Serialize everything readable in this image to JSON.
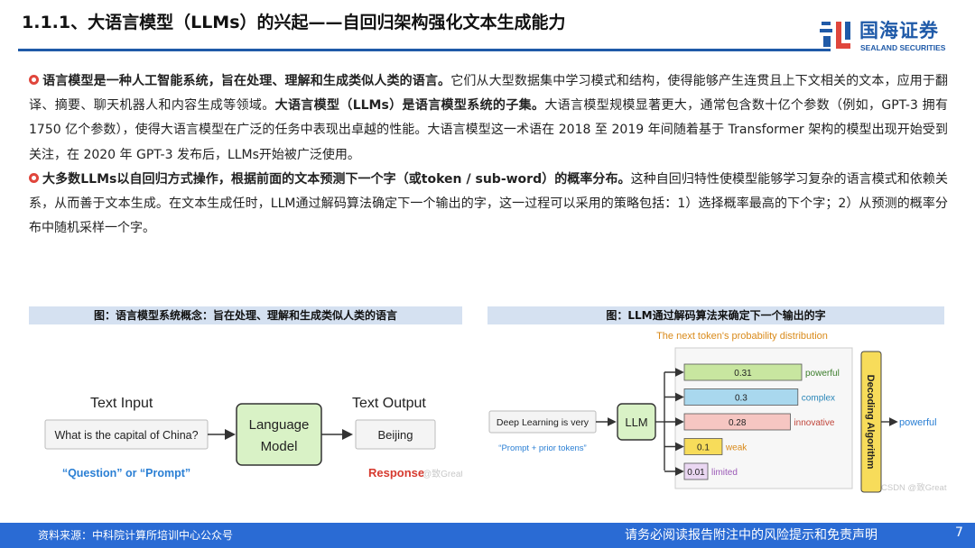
{
  "header": {
    "title": "1.1.1、大语言模型（LLMs）的兴起——自回归架构强化文本生成能力",
    "logo_cn": "国海证券",
    "logo_en": "SEALAND SECURITIES"
  },
  "body": {
    "p1_bold1": "语言模型是一种人工智能系统，旨在处理、理解和生成类似人类的语言。",
    "p1_text1": "它们从大型数据集中学习模式和结构，使得能够产生连贯且上下文相关的文本，应用于翻译、摘要、聊天机器人和内容生成等领域。",
    "p1_bold2": "大语言模型（LLMs）是语言模型系统的子集。",
    "p1_text2": "大语言模型规模显著更大，通常包含数十亿个参数（例如，GPT-3 拥有 1750 亿个参数），使得大语言模型在广泛的任务中表现出卓越的性能。大语言模型这一术语在 2018 至 2019 年间随着基于 Transformer 架构的模型出现开始受到关注，在 2020 年 GPT-3 发布后，LLMs开始被广泛使用。",
    "p2_bold": "大多数LLMs以自回归方式操作，根据前面的文本预测下一个字（或token / sub-word）的概率分布。",
    "p2_text": "这种自回归特性使模型能够学习复杂的语言模式和依赖关系，从而善于文本生成。在文本生成任时，LLM通过解码算法确定下一个输出的字，这一过程可以采用的策略包括：1）选择概率最高的下个字；2）从预测的概率分布中随机采样一个字。"
  },
  "fig_left": {
    "caption": "图：语言模型系统概念：旨在处理、理解和生成类似人类的语言",
    "text_input_label": "Text Input",
    "text_output_label": "Text Output",
    "input_box": "What is the capital of China?",
    "model_line1": "Language",
    "model_line2": "Model",
    "output_box": "Beijing",
    "question_label": "“Question” or “Prompt”",
    "response_label": "Response",
    "watermark": "@致Great"
  },
  "fig_right": {
    "caption": "图：LLM通过解码算法来确定下一个输出的字",
    "dist_title": "The next token's probability distribution",
    "input_box": "Deep Learning is very",
    "prompt_note": "“Prompt + prior tokens”",
    "llm_label": "LLM",
    "decoder_label": "Decoding Algorithm",
    "output_word": "powerful",
    "watermark": "CSDN @致Great",
    "tokens": [
      {
        "prob": 0.31,
        "prob_text": "0.31",
        "word": "powerful",
        "color": "#c8e6a0",
        "word_color": "#3a7d2a"
      },
      {
        "prob": 0.3,
        "prob_text": "0.3",
        "word": "complex",
        "color": "#a9d8ee",
        "word_color": "#2a86b8"
      },
      {
        "prob": 0.28,
        "prob_text": "0.28",
        "word": "innovative",
        "color": "#f6c6c2",
        "word_color": "#c0453a"
      },
      {
        "prob": 0.1,
        "prob_text": "0.1",
        "word": "weak",
        "color": "#f7dc5a",
        "word_color": "#d98a1a"
      },
      {
        "prob": 0.01,
        "prob_text": "0.01",
        "word": "limited",
        "color": "#ead7f2",
        "word_color": "#9b59b6"
      }
    ]
  },
  "footer": {
    "source": "资料来源：中科院计算所培训中心公众号",
    "disclaimer": "请务必阅读报告附注中的风险提示和免责声明",
    "page": "7"
  },
  "colors": {
    "brand_blue": "#1f5aa8",
    "footer_blue": "#2a6bd4",
    "bullet_red": "#e0463c",
    "caption_bg": "#d5e1f1"
  }
}
